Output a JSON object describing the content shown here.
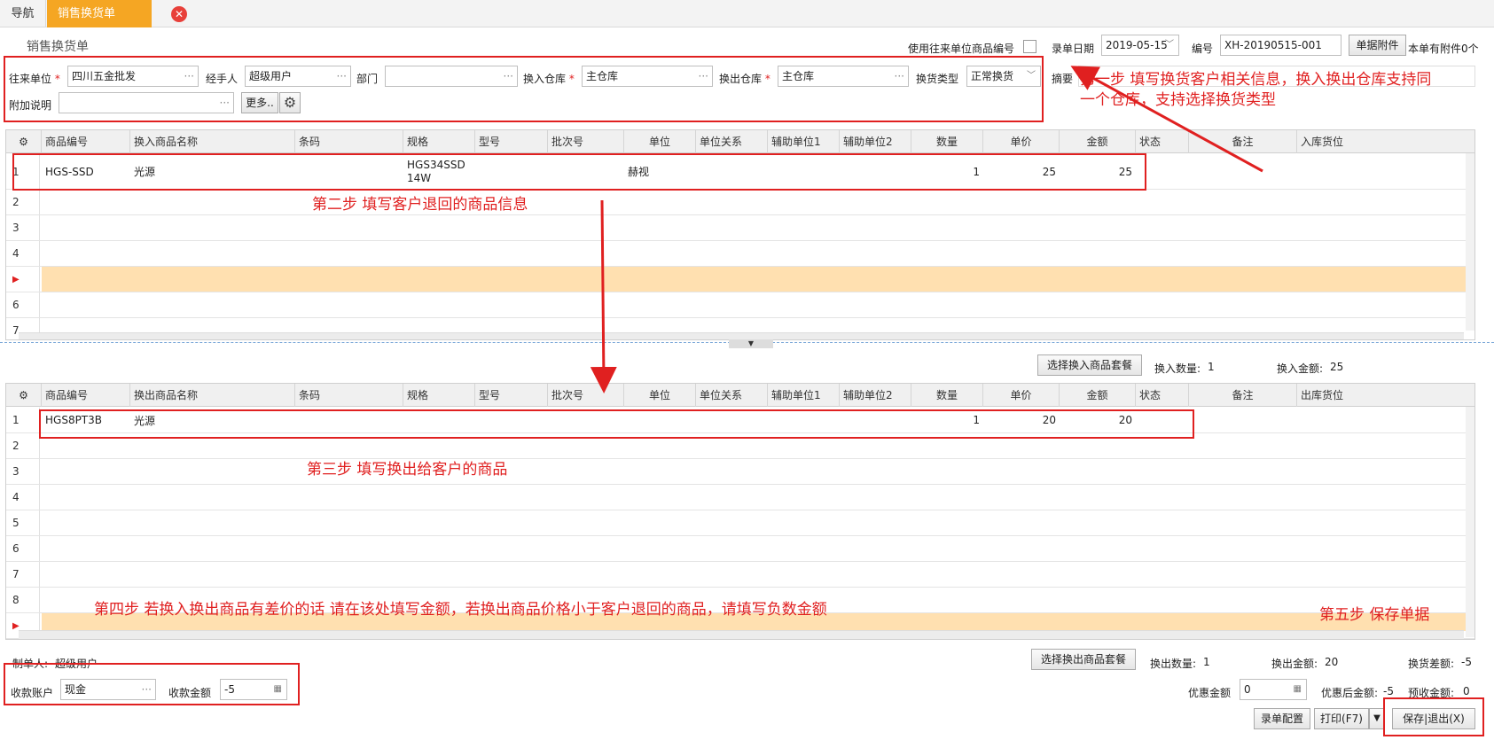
{
  "tabs": {
    "nav": "导航",
    "active": "销售换货单",
    "close": "✕"
  },
  "form_title": "销售换货单",
  "header": {
    "use_partner_code_label": "使用往来单位商品编号",
    "date_label": "录单日期",
    "date_value": "2019-05-15",
    "number_label": "编号",
    "number_value": "XH-20190515-001",
    "attach_button": "单据附件",
    "attach_count": "本单有附件0个"
  },
  "fields": {
    "partner_label": "往来单位",
    "partner_value": "四川五金批发",
    "handler_label": "经手人",
    "handler_value": "超级用户",
    "dept_label": "部门",
    "dept_value": "",
    "in_wh_label": "换入仓库",
    "in_wh_value": "主仓库",
    "out_wh_label": "换出仓库",
    "out_wh_value": "主仓库",
    "type_label": "换货类型",
    "type_value": "正常换货",
    "summary_label": "摘要",
    "extra_label": "附加说明",
    "extra_value": "",
    "more_button": "更多..",
    "required_mark": "*",
    "ellipsis": "···"
  },
  "in_grid": {
    "columns": [
      "商品编号",
      "换入商品名称",
      "条码",
      "规格",
      "型号",
      "批次号",
      "单位",
      "单位关系",
      "辅助单位1",
      "辅助单位2",
      "数量",
      "单价",
      "金额",
      "状态",
      "备注",
      "入库货位"
    ],
    "rows": [
      {
        "n": "1",
        "code": "HGS-SSD",
        "name": "光源",
        "spec": "HGS34SSD14W",
        "unit": "赫视",
        "qty": "1",
        "price": "25",
        "amount": "25"
      }
    ],
    "row_numbers": [
      "2",
      "3",
      "4",
      "▶",
      "6",
      "7"
    ]
  },
  "in_summary": {
    "button": "选择换入商品套餐",
    "qty_label": "换入数量:",
    "qty_value": "1",
    "amt_label": "换入金额:",
    "amt_value": "25"
  },
  "out_grid": {
    "columns": [
      "商品编号",
      "换出商品名称",
      "条码",
      "规格",
      "型号",
      "批次号",
      "单位",
      "单位关系",
      "辅助单位1",
      "辅助单位2",
      "数量",
      "单价",
      "金额",
      "状态",
      "备注",
      "出库货位"
    ],
    "rows": [
      {
        "n": "1",
        "code": "HGS8PT3B",
        "name": "光源",
        "qty": "1",
        "price": "20",
        "amount": "20"
      }
    ],
    "row_numbers": [
      "2",
      "3",
      "4",
      "5",
      "6",
      "7",
      "8",
      "▶"
    ]
  },
  "footer": {
    "maker_label": "制单人:",
    "maker_value": "超级用户",
    "out_button": "选择换出商品套餐",
    "out_qty_label": "换出数量:",
    "out_qty_value": "1",
    "out_amt_label": "换出金额:",
    "out_amt_value": "20",
    "diff_label": "换货差额:",
    "diff_value": "-5",
    "account_label": "收款账户",
    "account_value": "现金",
    "receive_label": "收款金额",
    "receive_value": "-5",
    "discount_label": "优惠金额",
    "discount_value": "0",
    "after_discount_label": "优惠后金额:",
    "after_discount_value": "-5",
    "prepaid_label": "预收金额:",
    "prepaid_value": "0",
    "config_button": "录单配置",
    "print_button": "打印(F7)",
    "save_button": "保存|退出(X)"
  },
  "annotations": {
    "step1_line1": "第一步 填写换货客户相关信息，换入换出仓库支持同",
    "step1_line2": "一个仓库，支持选择换货类型",
    "step2": "第二步 填写客户退回的商品信息",
    "step3": "第三步 填写换出给客户的商品",
    "step4": "第四步 若换入换出商品有差价的话 请在该处填写金额，若换出商品价格小于客户退回的商品，请填写负数金额",
    "step5": "第五步 保存单据"
  },
  "colors": {
    "tab_active": "#f5a623",
    "annotation": "#e02020",
    "selected_row": "#ffe0b0"
  }
}
